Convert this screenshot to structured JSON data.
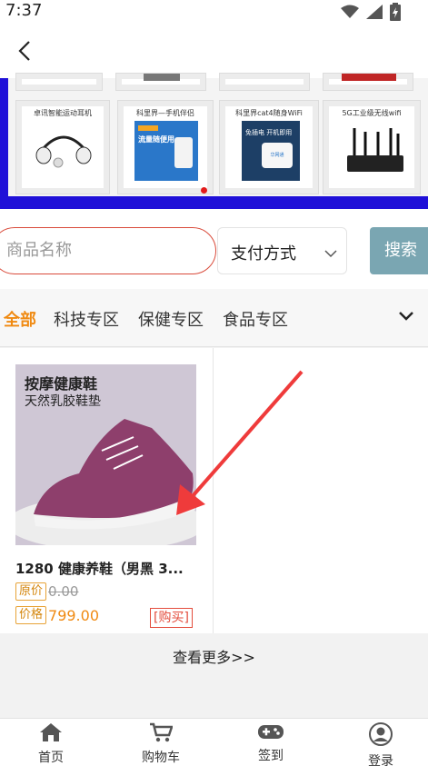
{
  "status": {
    "time": "7:37"
  },
  "banner": {
    "tiles": [
      {
        "title": "卓讯智能运动耳机"
      },
      {
        "title": "科里界—手机伴侣"
      },
      {
        "title": "科里界cat4随身WiFi"
      },
      {
        "title": "5G工业级无线wifi"
      }
    ],
    "tile_subtexts": [
      "流量随便用",
      "免插电 开机即用",
      "华网通"
    ]
  },
  "search": {
    "placeholder": "商品名称",
    "payment_label": "支付方式",
    "button_label": "搜索"
  },
  "tabs": [
    {
      "label": "全部",
      "active": true
    },
    {
      "label": "科技专区"
    },
    {
      "label": "保健专区"
    },
    {
      "label": "食品专区"
    }
  ],
  "products": [
    {
      "image_title": "按摩健康鞋",
      "image_subtitle": "天然乳胶鞋垫",
      "name": "1280 健康养鞋（男黑 3...",
      "orig_label": "原价",
      "orig_price": "0.00",
      "price_label": "价格",
      "price": "799.00",
      "buy_label": "[购买]"
    }
  ],
  "see_more": "查看更多>>",
  "bottom_nav": [
    {
      "label": "首页",
      "icon": "home-icon"
    },
    {
      "label": "购物车",
      "icon": "cart-icon"
    },
    {
      "label": "签到",
      "icon": "gamepad-icon"
    },
    {
      "label": "登录",
      "icon": "user-icon"
    }
  ],
  "colors": {
    "accent": "#f08a12",
    "banner_blue": "#1f10d8",
    "search_button": "#7aa6b2",
    "buy_red": "#e34c3c",
    "arrow_red": "#ef3b3b"
  }
}
